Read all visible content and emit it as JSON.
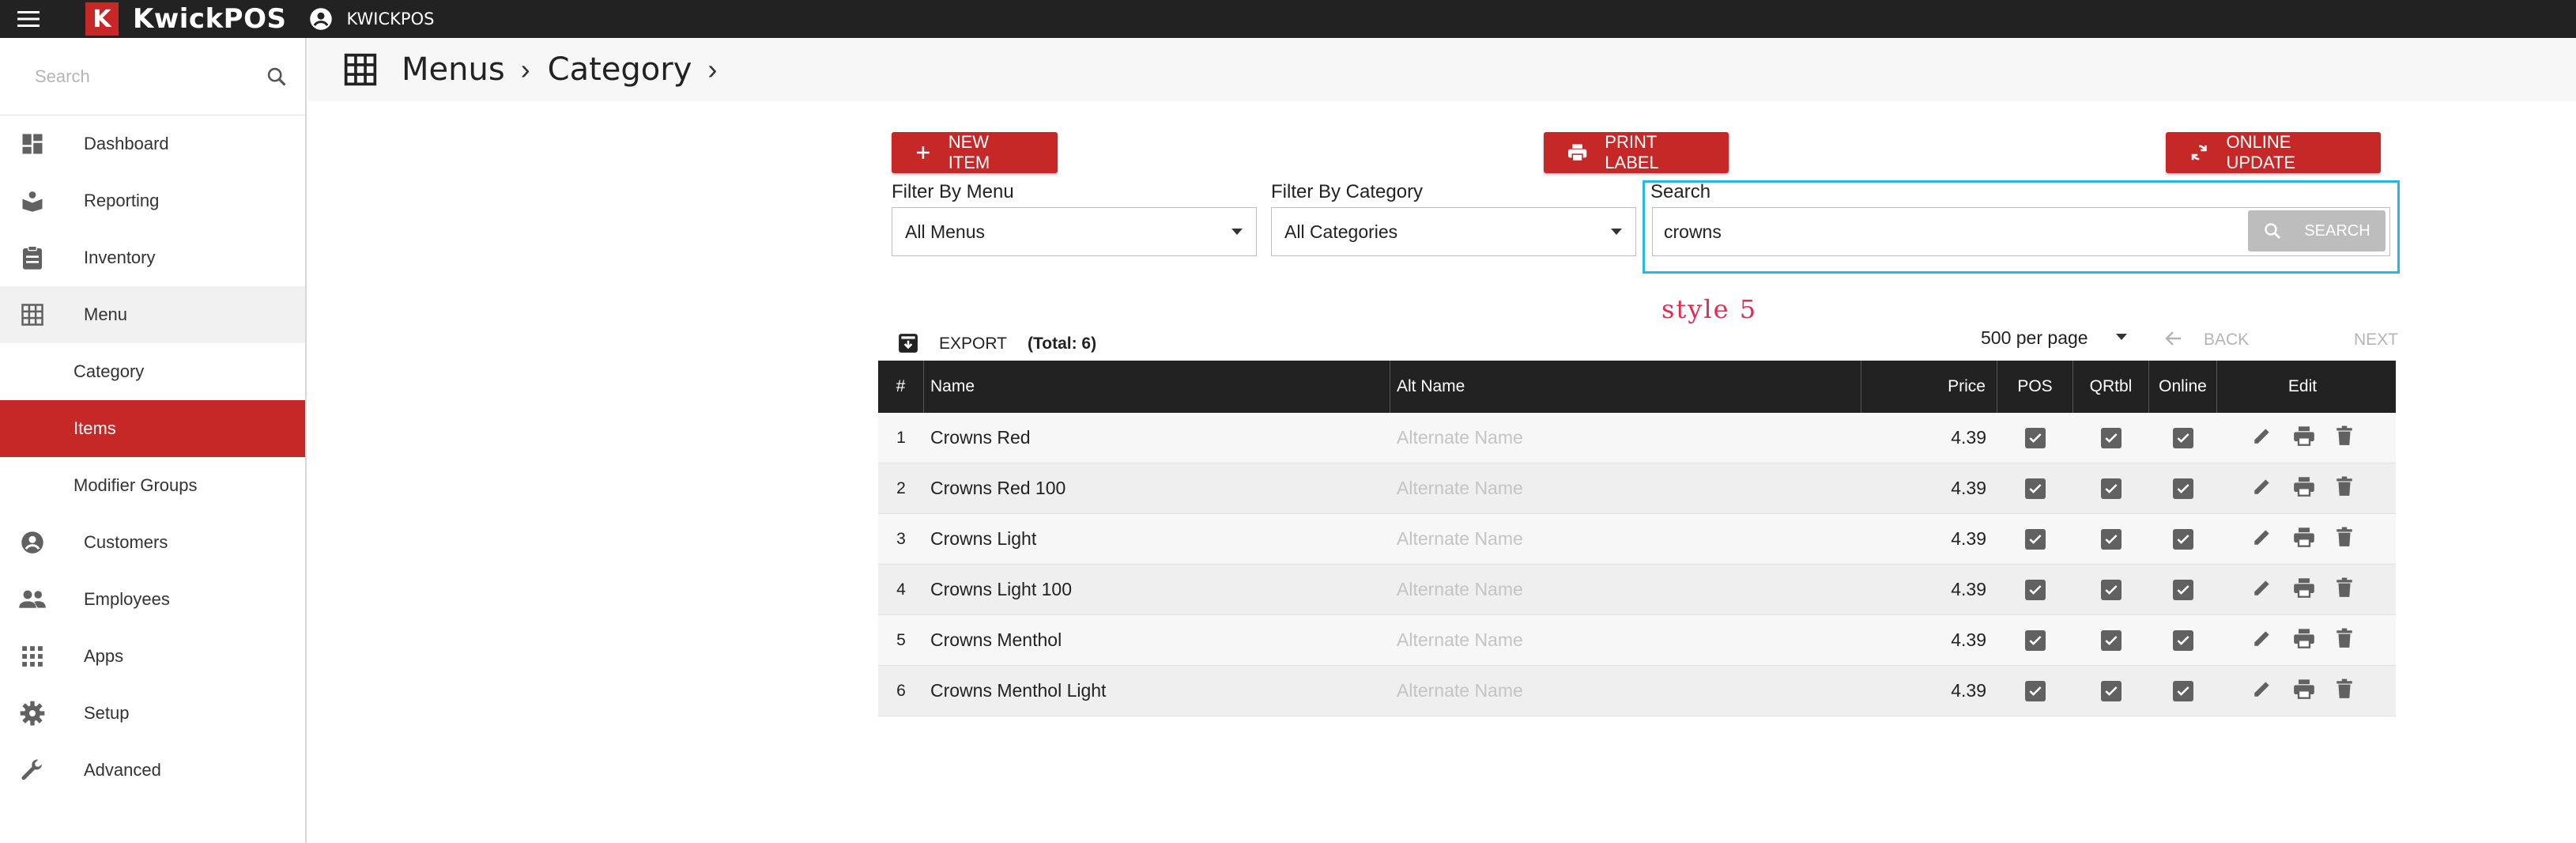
{
  "app": {
    "brand": "KwickPOS",
    "logo_letter": "K",
    "user": "KWICKPOS"
  },
  "sidebar": {
    "search_placeholder": "Search",
    "items": [
      {
        "label": "Dashboard",
        "icon": "dashboard-icon"
      },
      {
        "label": "Reporting",
        "icon": "reporting-icon"
      },
      {
        "label": "Inventory",
        "icon": "inventory-icon"
      },
      {
        "label": "Menu",
        "icon": "grid-icon"
      },
      {
        "label": "Category"
      },
      {
        "label": "Items"
      },
      {
        "label": "Modifier Groups"
      },
      {
        "label": "Customers",
        "icon": "customer-icon"
      },
      {
        "label": "Employees",
        "icon": "employees-icon"
      },
      {
        "label": "Apps",
        "icon": "apps-icon"
      },
      {
        "label": "Setup",
        "icon": "gear-icon"
      },
      {
        "label": "Advanced",
        "icon": "wrench-icon"
      }
    ]
  },
  "breadcrumb": [
    "Menus",
    "Category"
  ],
  "actions": {
    "new_item": "NEW ITEM",
    "print_label": "PRINT LABEL",
    "online_update": "ONLINE UPDATE"
  },
  "filters": {
    "menu_label": "Filter By Menu",
    "menu_value": "All Menus",
    "category_label": "Filter By Category",
    "category_value": "All Categories",
    "search_label": "Search",
    "search_value": "crowns",
    "search_button": "SEARCH"
  },
  "annotation": "style 5",
  "table_toolbar": {
    "export": "EXPORT",
    "total": "(Total: 6)",
    "per_page": "500 per page",
    "back": "BACK",
    "next": "NEXT"
  },
  "table": {
    "columns": [
      "#",
      "Name",
      "Alt Name",
      "Price",
      "POS",
      "QRtbl",
      "Online",
      "Edit"
    ],
    "alt_placeholder": "Alternate Name",
    "rows": [
      {
        "num": "1",
        "name": "Crowns Red",
        "price": "4.39",
        "pos": true,
        "qrtbl": true,
        "online": true
      },
      {
        "num": "2",
        "name": "Crowns Red 100",
        "price": "4.39",
        "pos": true,
        "qrtbl": true,
        "online": true
      },
      {
        "num": "3",
        "name": "Crowns Light",
        "price": "4.39",
        "pos": true,
        "qrtbl": true,
        "online": true
      },
      {
        "num": "4",
        "name": "Crowns Light 100",
        "price": "4.39",
        "pos": true,
        "qrtbl": true,
        "online": true
      },
      {
        "num": "5",
        "name": "Crowns Menthol",
        "price": "4.39",
        "pos": true,
        "qrtbl": true,
        "online": true
      },
      {
        "num": "6",
        "name": "Crowns Menthol Light",
        "price": "4.39",
        "pos": true,
        "qrtbl": true,
        "online": true
      }
    ]
  },
  "colors": {
    "brand_red": "#c62828",
    "topbar": "#222222",
    "highlight_box": "#29b6e5",
    "annotation": "#e32b4f"
  }
}
